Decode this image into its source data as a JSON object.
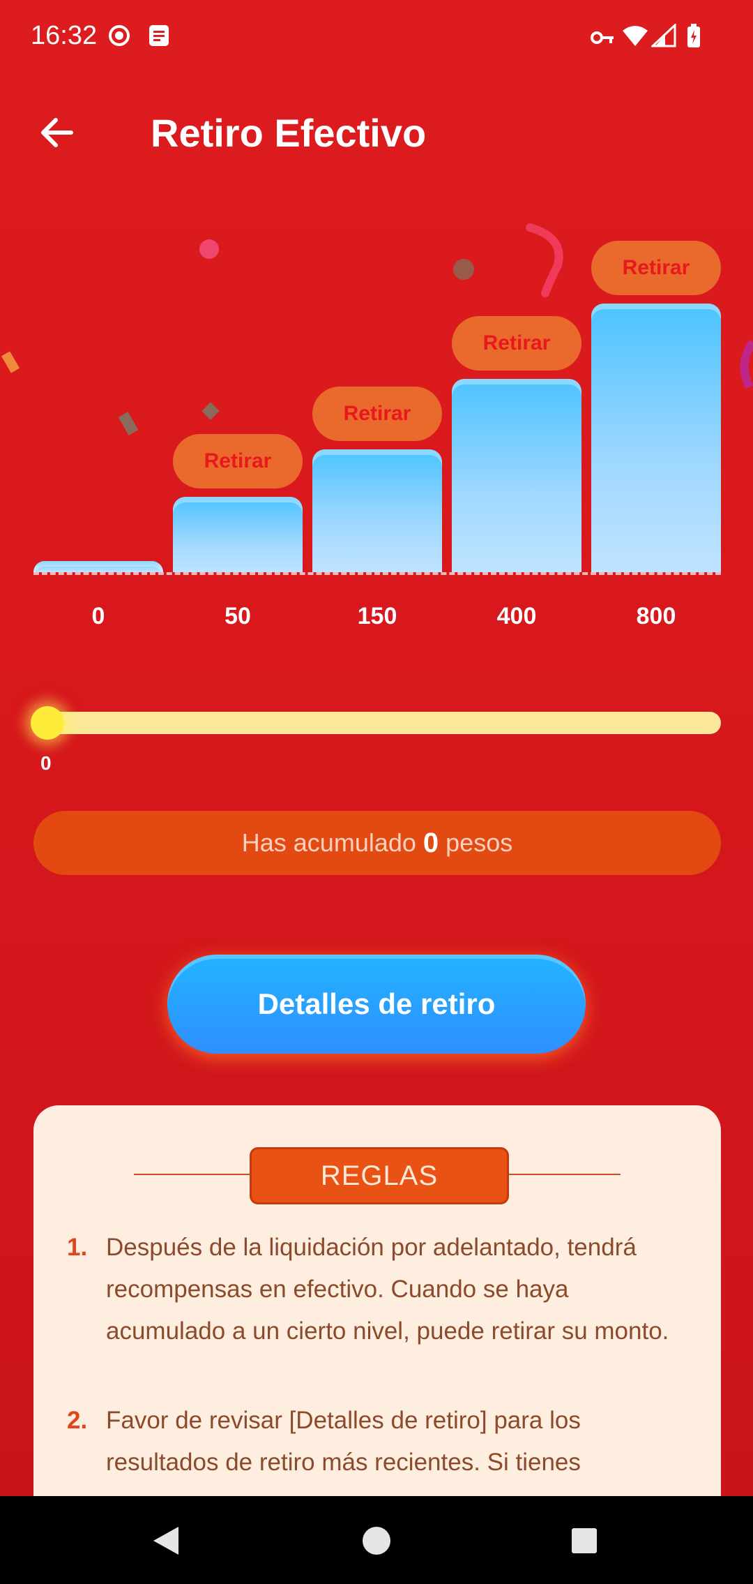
{
  "status": {
    "time": "16:32"
  },
  "header": {
    "title": "Retiro Efectivo"
  },
  "chart_data": {
    "type": "bar",
    "categories": [
      "0",
      "50",
      "150",
      "400",
      "800"
    ],
    "values": [
      0,
      50,
      150,
      400,
      800
    ],
    "button_label": "Retirar",
    "buttons_on": [
      false,
      true,
      true,
      true,
      true
    ],
    "bar_color": "#5cc8ff"
  },
  "progress": {
    "value": 0,
    "label": "0"
  },
  "accumulated": {
    "prefix": "Has acumulado",
    "amount": "0",
    "suffix": "pesos"
  },
  "details_button": "Detalles de retiro",
  "rules": {
    "title": "REGLAS",
    "items": [
      {
        "num": "1.",
        "text": "Después de la liquidación por adelantado, tendrá recompensas en efectivo. Cuando se haya acumulado a un cierto nivel, puede retirar su monto."
      },
      {
        "num": "2.",
        "text": "Favor de revisar [Detalles de retiro] para los resultados de retiro más recientes. Si tienes"
      }
    ]
  },
  "colors": {
    "background": "#dd1c1f",
    "accent_orange": "#e85214",
    "button_blue": "#2a9cff",
    "track": "#fbe89a"
  }
}
